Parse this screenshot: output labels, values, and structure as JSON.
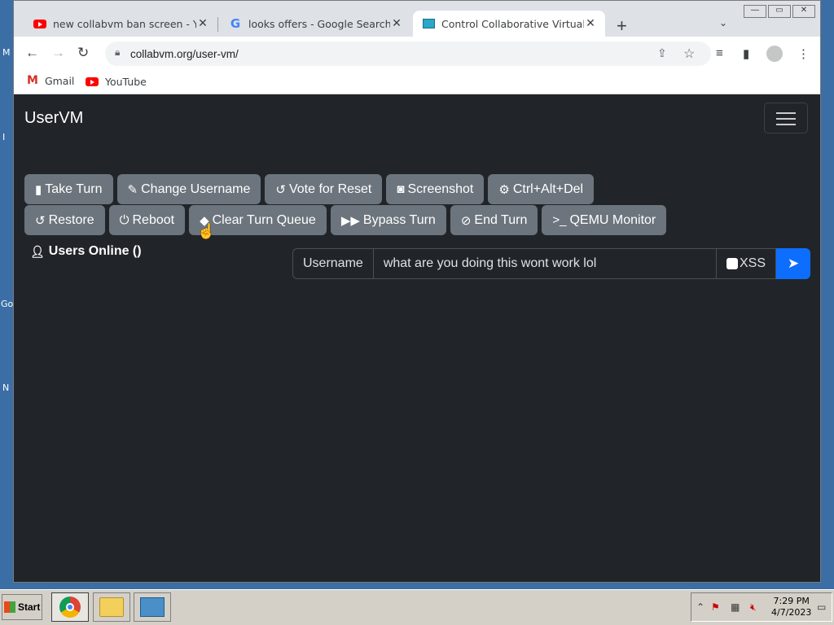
{
  "desktop": {
    "sliver_glyphs": [
      "M",
      "I",
      "Go",
      "N"
    ]
  },
  "browser": {
    "tabs": [
      {
        "title": "new collabvm ban screen - YouTube",
        "icon": "youtube-icon"
      },
      {
        "title": "looks offers - Google Search",
        "icon": "google-icon"
      },
      {
        "title": "Control Collaborative Virtual Machines",
        "icon": "monitor-icon",
        "active": true
      }
    ],
    "new_tab": "+",
    "tab_search": "⌄",
    "window_buttons": [
      "—",
      "▭",
      "✕"
    ],
    "url": "collabvm.org/user-vm/",
    "bookmarks": [
      {
        "label": "Gmail",
        "icon": "gmail-icon"
      },
      {
        "label": "YouTube",
        "icon": "youtube-icon"
      }
    ]
  },
  "page": {
    "brand": "UserVM",
    "row1": [
      {
        "label": "Take Turn",
        "icon": "mouse-icon"
      },
      {
        "label": "Change Username",
        "icon": "user-edit-icon"
      },
      {
        "label": "Vote for Reset",
        "icon": "undo-icon"
      },
      {
        "label": "Screenshot",
        "icon": "camera-icon"
      },
      {
        "label": "Ctrl+Alt+Del",
        "icon": "gear-icon"
      }
    ],
    "row2": [
      {
        "label": "Restore",
        "icon": "undo-icon"
      },
      {
        "label": "Reboot",
        "icon": "power-icon"
      },
      {
        "label": "Clear Turn Queue",
        "icon": "eraser-icon"
      },
      {
        "label": "Bypass Turn",
        "icon": "fast-forward-icon"
      },
      {
        "label": "End Turn",
        "icon": "ban-icon"
      },
      {
        "label": "QEMU Monitor",
        "icon": "terminal-icon"
      }
    ],
    "users_online": "Users Online ()",
    "chat": {
      "username_label": "Username",
      "message_value": "what are you doing this wont work lol",
      "xss_label": "XSS"
    }
  },
  "taskbar": {
    "start_label": "Start",
    "time": "7:29 PM",
    "date": "4/7/2023"
  },
  "colors": {
    "page_bg": "#212529",
    "button": "#6c757d",
    "send": "#0d6efd"
  }
}
